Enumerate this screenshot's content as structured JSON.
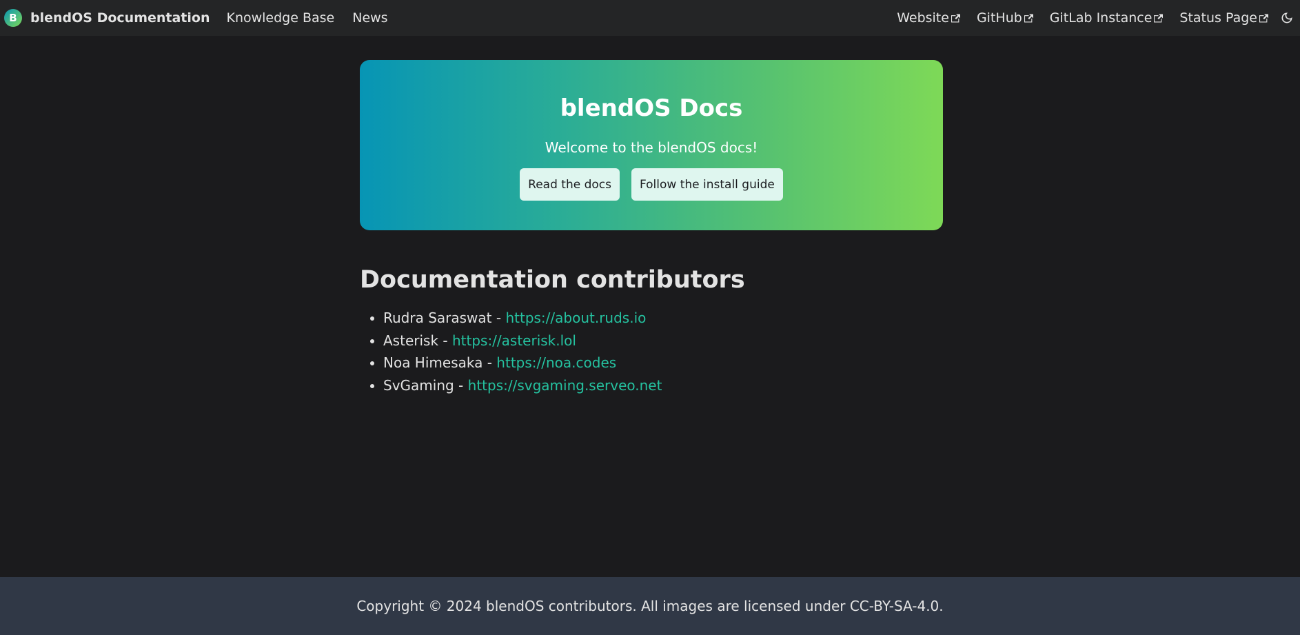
{
  "navbar": {
    "logo_letter": "B",
    "brand_title": "blendOS Documentation",
    "left_links": [
      {
        "label": "Knowledge Base"
      },
      {
        "label": "News"
      }
    ],
    "right_links": [
      {
        "label": "Website",
        "icon": "external-link-icon"
      },
      {
        "label": "GitHub",
        "icon": "external-link-icon"
      },
      {
        "label": "GitLab Instance",
        "icon": "external-link-icon"
      },
      {
        "label": "Status Page",
        "icon": "external-link-icon"
      }
    ],
    "theme_toggle_icon": "moon-icon"
  },
  "hero": {
    "title": "blendOS Docs",
    "subtitle": "Welcome to the blendOS docs!",
    "buttons": [
      {
        "label": "Read the docs"
      },
      {
        "label": "Follow the install guide"
      }
    ]
  },
  "contributors": {
    "heading": "Documentation contributors",
    "items": [
      {
        "name": "Rudra Saraswat",
        "separator": " - ",
        "url": "https://about.ruds.io"
      },
      {
        "name": "Asterisk",
        "separator": " - ",
        "url": "https://asterisk.lol"
      },
      {
        "name": "Noa Himesaka",
        "separator": " - ",
        "url": "https://noa.codes"
      },
      {
        "name": "SvGaming",
        "separator": " - ",
        "url": "https://svgaming.serveo.net"
      }
    ]
  },
  "footer": {
    "copyright": "Copyright © 2024 blendOS contributors. All images are licensed under CC-BY-SA-4.0."
  },
  "colors": {
    "page_background": "#1b1b1d",
    "navbar_background": "#242526",
    "footer_background": "#303846",
    "link": "#25c2a0",
    "hero_gradient_start": "#0795b5",
    "hero_gradient_end": "#7ed957"
  }
}
